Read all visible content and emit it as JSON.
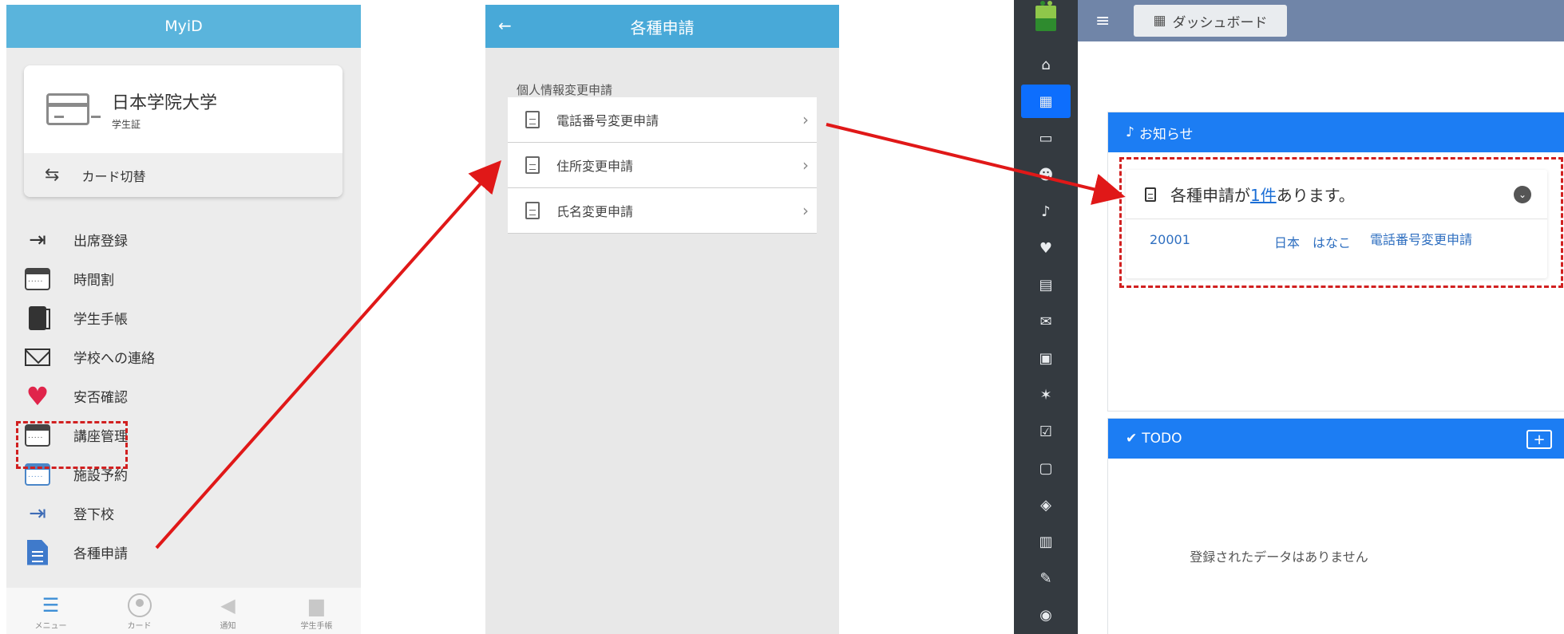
{
  "phone1": {
    "header_title": "MyiD",
    "card": {
      "university": "日本学院大学",
      "type": "学生証",
      "switch_label": "カード切替"
    },
    "menu": [
      {
        "label": "出席登録",
        "icon": "enter-icon"
      },
      {
        "label": "時間割",
        "icon": "calendar-icon"
      },
      {
        "label": "学生手帳",
        "icon": "notebook-icon"
      },
      {
        "label": "学校への連絡",
        "icon": "mail-icon"
      },
      {
        "label": "安否確認",
        "icon": "heart-icon"
      },
      {
        "label": "講座管理",
        "icon": "calendar-icon"
      },
      {
        "label": "施設予約",
        "icon": "calendar-blue-icon"
      },
      {
        "label": "登下校",
        "icon": "enter-blue-icon"
      },
      {
        "label": "各種申請",
        "icon": "document-icon"
      }
    ],
    "tabs": [
      {
        "label": "メニュー",
        "active": true
      },
      {
        "label": "カード",
        "active": false
      },
      {
        "label": "通知",
        "active": false
      },
      {
        "label": "学生手帳",
        "active": false
      }
    ]
  },
  "phone2": {
    "header_title": "各種申請",
    "section_label": "個人情報変更申請",
    "items": [
      {
        "label": "電話番号変更申請"
      },
      {
        "label": "住所変更申請"
      },
      {
        "label": "氏名変更申請"
      }
    ]
  },
  "webapp": {
    "dashboard_label": "ダッシュボード",
    "news_header": "お知らせ",
    "notice": {
      "text_prefix": "各種申請が",
      "count_link": "1件",
      "text_suffix": "あります。",
      "row": {
        "id": "20001",
        "name": "日本　はなこ",
        "request": "電話番号変更申請"
      }
    },
    "todo_header": "TODO",
    "todo_empty": "登録されたデータはありません",
    "sidebar_icons": [
      "home-icon",
      "dashboard-icon",
      "id-card-icon",
      "users-icon",
      "bell-icon",
      "heartbeat-icon",
      "book-icon",
      "envelope-icon",
      "train-icon",
      "walking-icon",
      "calendar-check-icon",
      "chalkboard-icon",
      "box-icon",
      "clipboard-icon",
      "pencil-icon",
      "database-icon"
    ]
  },
  "colors": {
    "phone_header": "#5ab4dc",
    "panel_header": "#1c7df3",
    "annotation_red": "#d12020",
    "sidebar_bg": "#343a40"
  }
}
